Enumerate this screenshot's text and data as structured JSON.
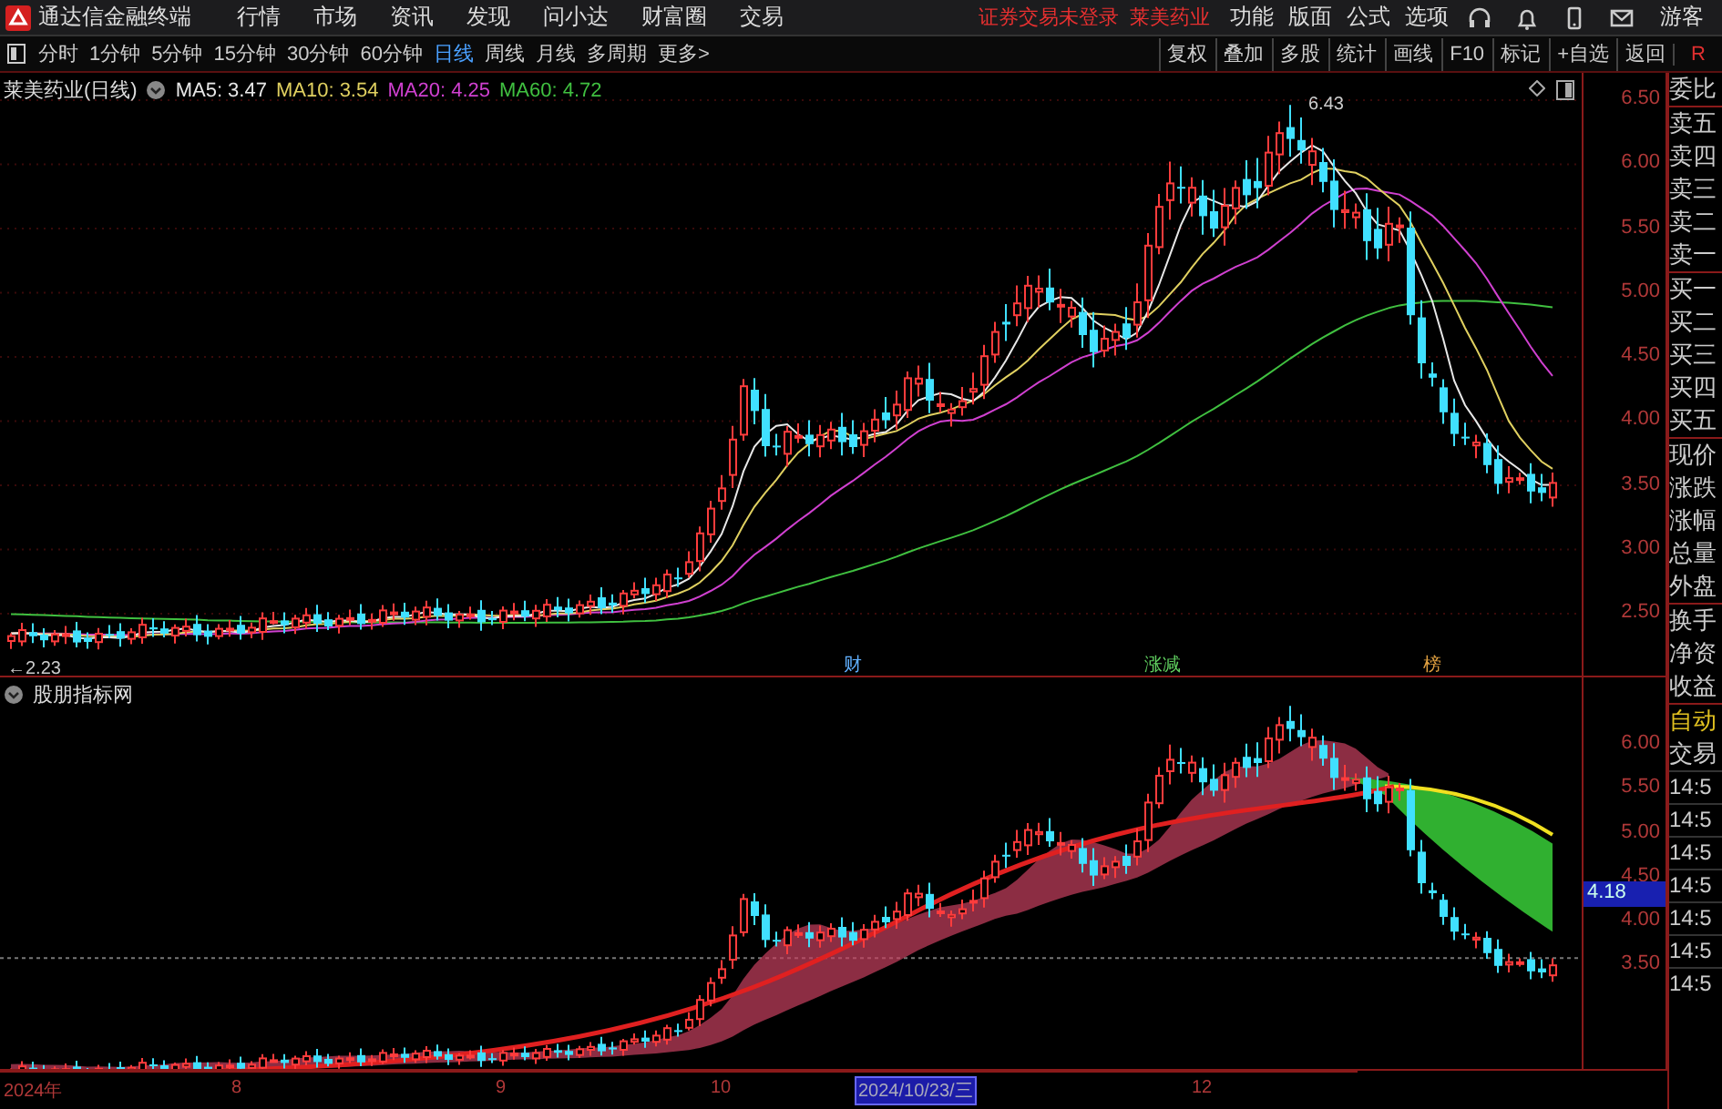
{
  "title_bar": {
    "app_name": "通达信金融终端",
    "menus": [
      "行情",
      "市场",
      "资讯",
      "发现",
      "问小达",
      "财富圈",
      "交易"
    ],
    "notices": [
      "证券交易未登录",
      "莱美药业"
    ],
    "right_menus": [
      "功能",
      "版面",
      "公式",
      "选项"
    ],
    "user": "游客"
  },
  "toolbar": {
    "periods": [
      {
        "label": "分时",
        "selected": false
      },
      {
        "label": "1分钟",
        "selected": false
      },
      {
        "label": "5分钟",
        "selected": false
      },
      {
        "label": "15分钟",
        "selected": false
      },
      {
        "label": "30分钟",
        "selected": false
      },
      {
        "label": "60分钟",
        "selected": false
      },
      {
        "label": "日线",
        "selected": true
      },
      {
        "label": "周线",
        "selected": false
      },
      {
        "label": "月线",
        "selected": false
      },
      {
        "label": "多周期",
        "selected": false
      },
      {
        "label": "更多>",
        "selected": false
      }
    ],
    "buttons": [
      "复权",
      "叠加",
      "多股",
      "统计",
      "画线",
      "F10",
      "标记",
      "+自选",
      "返回"
    ],
    "corner": "R"
  },
  "main_chart": {
    "title": "莱美药业(日线)",
    "ma": [
      {
        "label": "MA5: 3.47",
        "color": "#e8e8e8"
      },
      {
        "label": "MA10: 3.54",
        "color": "#e0d060"
      },
      {
        "label": "MA20: 4.25",
        "color": "#d040d0"
      },
      {
        "label": "MA60: 4.72",
        "color": "#40c040"
      }
    ],
    "price_ticks": [
      "6.50",
      "6.00",
      "5.50",
      "5.00",
      "4.50",
      "4.00",
      "3.50",
      "3.00",
      "2.50"
    ],
    "annotations": [
      "6.43",
      "←2.23"
    ],
    "event_marks": [
      {
        "text": "财",
        "color": "#60b0ff"
      },
      {
        "text": "涨减",
        "color": "#60d060"
      },
      {
        "text": "榜",
        "color": "#e0a040"
      }
    ]
  },
  "indicator_chart": {
    "title": "股朋指标网",
    "price_ticks": [
      "6.00",
      "5.50",
      "5.00",
      "4.50",
      "4.00",
      "3.50"
    ],
    "current_value": "4.18"
  },
  "date_axis": [
    {
      "text": "2024年",
      "selected": false
    },
    {
      "text": "8",
      "selected": false
    },
    {
      "text": "9",
      "selected": false
    },
    {
      "text": "10",
      "selected": false
    },
    {
      "text": "2024/10/23/三",
      "selected": true
    },
    {
      "text": "12",
      "selected": false
    }
  ],
  "quote_panel": {
    "labels": [
      "委比",
      "卖五",
      "卖四",
      "卖三",
      "卖二",
      "卖一",
      "买一",
      "买二",
      "买三",
      "买四",
      "买五",
      "现价",
      "涨跌",
      "涨幅",
      "总量",
      "外盘",
      "换手",
      "净资",
      "收益"
    ],
    "auto": "自动",
    "trade": "交易",
    "times": [
      "14:5",
      "14:5",
      "14:5",
      "14:5",
      "14:5",
      "14:5",
      "14:5"
    ]
  }
}
